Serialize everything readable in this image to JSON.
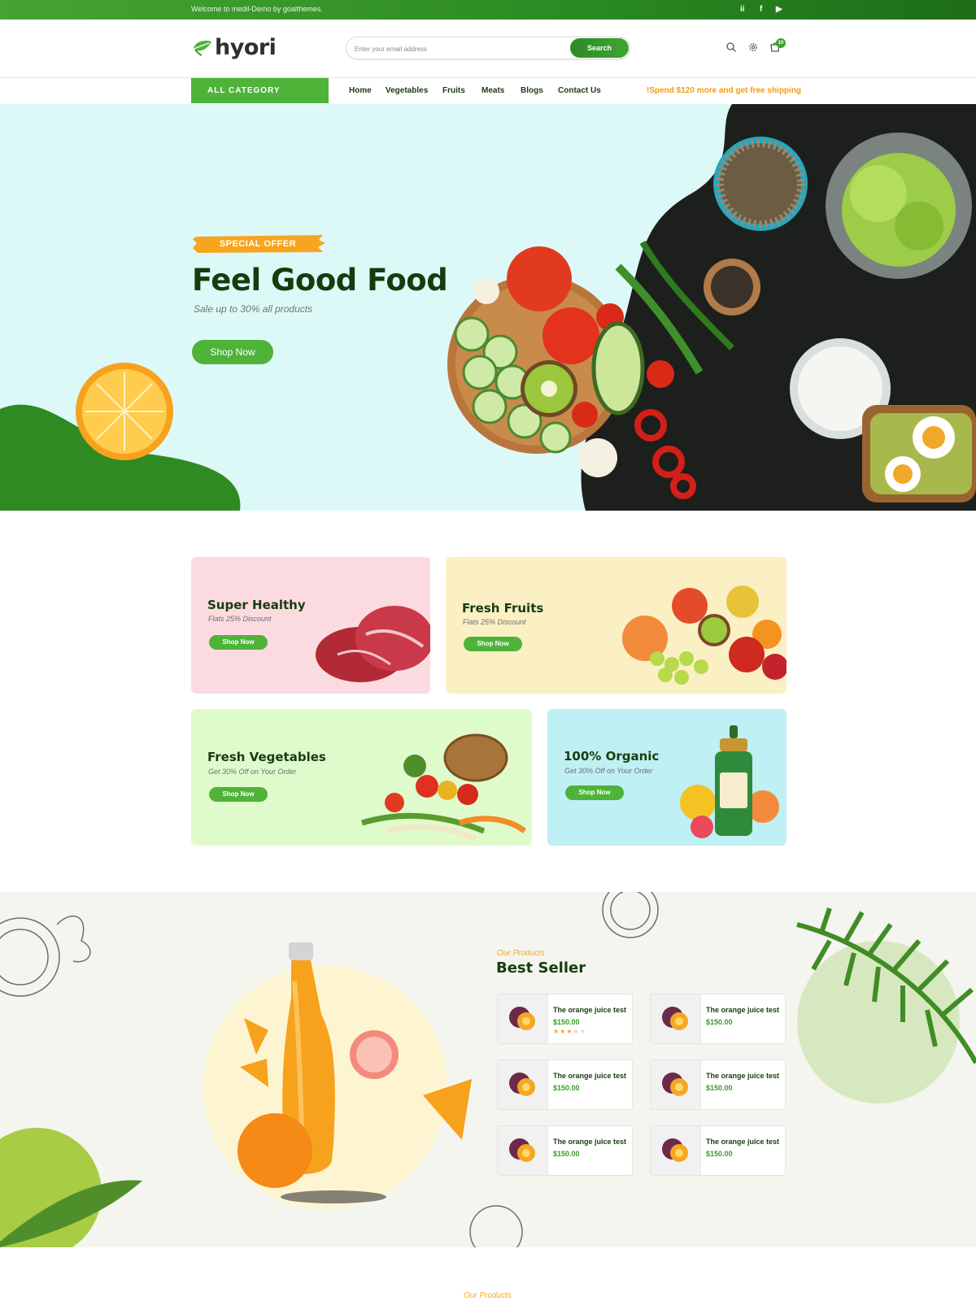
{
  "topbar": {
    "welcome": "Welcome to medil-Demo by goalthemes.",
    "social": [
      "ii",
      "f",
      "▶"
    ]
  },
  "header": {
    "logo": "hyori",
    "search_placeholder": "Enter your email address",
    "search_button": "Search",
    "cart_count": "10"
  },
  "nav": {
    "all_category": "ALL CATEGORY",
    "items": [
      "Home",
      "Vegetables",
      "Fruits",
      "Meats",
      "Blogs",
      "Contact Us"
    ],
    "promo": "!Spend $120 more and get free shipping"
  },
  "hero": {
    "badge": "SPECIAL OFFER",
    "title": "Feel Good Food",
    "subtitle": "Sale up to 30% all products",
    "button": "Shop Now"
  },
  "banners": [
    {
      "title": "Super Healthy",
      "subtitle": "Flats 25% Discount",
      "button": "Shop Now",
      "bg": "#fcdbe0"
    },
    {
      "title": "Fresh Fruits",
      "subtitle": "Flats 25% Discount",
      "button": "Shop Now",
      "bg": "#fbefc4"
    },
    {
      "title": "Fresh Vegetables",
      "subtitle": "Get 30% Off on Your Order",
      "button": "Shop Now",
      "bg": "#e0fbcb"
    },
    {
      "title": "100% Organic",
      "subtitle": "Get 30% Off on Your Order",
      "button": "Shop Now",
      "bg": "#bff0f3"
    }
  ],
  "best_seller": {
    "eyebrow": "Our Products",
    "title": "Best Seller",
    "products": [
      {
        "name": "The orange juice test",
        "price": "$150.00",
        "rating": 3
      },
      {
        "name": "The orange juice test",
        "price": "$150.00"
      },
      {
        "name": "The orange juice test",
        "price": "$150.00"
      },
      {
        "name": "The orange juice test",
        "price": "$150.00"
      },
      {
        "name": "The orange juice test",
        "price": "$150.00"
      },
      {
        "name": "The orange juice test",
        "price": "$150.00"
      }
    ]
  },
  "next_section": {
    "eyebrow": "Our Products"
  },
  "colors": {
    "brand_green": "#4fb33a",
    "dark_green": "#173d10",
    "accent_orange": "#f5a623"
  }
}
